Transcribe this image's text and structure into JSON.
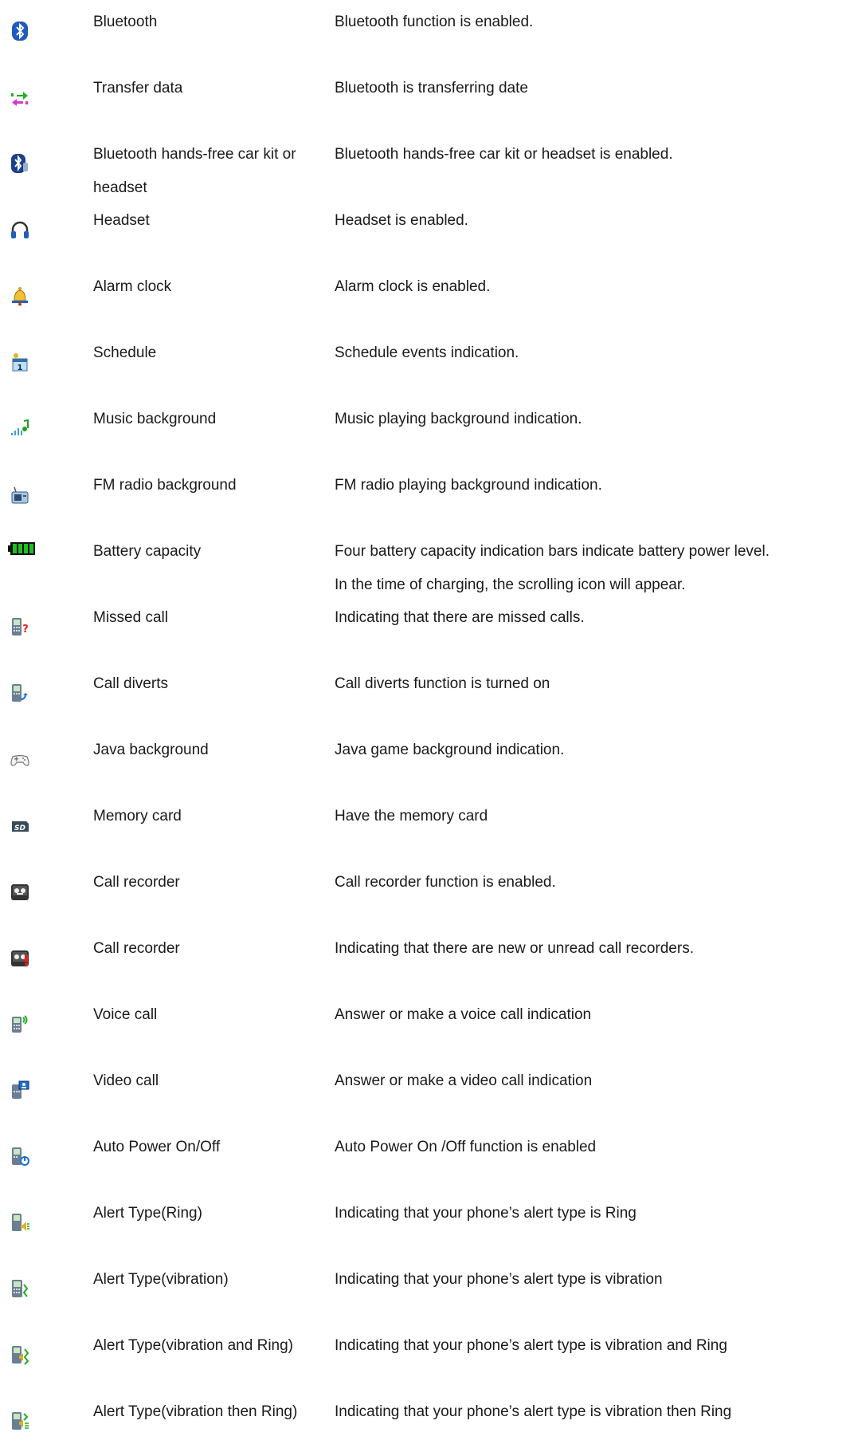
{
  "rows": [
    {
      "icon": "bluetooth-icon",
      "name": "Bluetooth",
      "description": "Bluetooth function is enabled."
    },
    {
      "icon": "transfer-data-icon",
      "name": "Transfer data",
      "description": "Bluetooth is transferring date"
    },
    {
      "icon": "bluetooth-headset-icon",
      "name": "Bluetooth hands-free car kit or headset",
      "description": "Bluetooth hands-free car kit or headset is enabled."
    },
    {
      "icon": "headset-icon",
      "name": "Headset",
      "description": "Headset is enabled."
    },
    {
      "icon": "alarm-bell-icon",
      "name": "Alarm clock",
      "description": "Alarm clock is enabled."
    },
    {
      "icon": "schedule-calendar-icon",
      "name": "Schedule",
      "description": "Schedule events indication."
    },
    {
      "icon": "music-note-icon",
      "name": "Music background",
      "description": "Music playing background indication."
    },
    {
      "icon": "fm-radio-icon",
      "name": "FM radio background",
      "description": "FM radio playing background indication."
    },
    {
      "icon": "battery-icon",
      "name": "Battery capacity",
      "description": "Four battery capacity indication bars indicate battery power level.",
      "description_line2": "In the time of charging, the scrolling icon will appear."
    },
    {
      "icon": "missed-call-icon",
      "name": "Missed call",
      "description": "Indicating that there are missed calls."
    },
    {
      "icon": "call-divert-icon",
      "name": "Call diverts",
      "description": "Call diverts function is turned on"
    },
    {
      "icon": "gamepad-icon",
      "name": "Java background",
      "description": "Java game background indication."
    },
    {
      "icon": "memory-card-icon",
      "name": "Memory card",
      "description": "Have the memory card"
    },
    {
      "icon": "call-recorder-icon",
      "name": "Call recorder",
      "description": "Call recorder function is enabled."
    },
    {
      "icon": "call-recorder-new-icon",
      "name": "Call recorder",
      "description": "Indicating that there are new or unread call recorders."
    },
    {
      "icon": "voice-call-icon",
      "name": "Voice call",
      "description": "Answer or make a voice call indication"
    },
    {
      "icon": "video-call-icon",
      "name": "Video call",
      "description": "Answer or make a video call indication"
    },
    {
      "icon": "auto-power-icon",
      "name": "Auto Power On/Off",
      "description": "Auto Power On /Off function is enabled"
    },
    {
      "icon": "alert-ring-icon",
      "name": "Alert Type(Ring)",
      "description": "Indicating that your phone’s alert type is Ring"
    },
    {
      "icon": "alert-vibration-icon",
      "name": "Alert Type(vibration)",
      "description": "Indicating that your phone’s alert type is vibration"
    },
    {
      "icon": "alert-vibration-ring-icon",
      "name": "Alert Type(vibration and Ring)",
      "description": "Indicating that your phone’s alert type is vibration and Ring"
    },
    {
      "icon": "alert-vibration-then-ring-icon",
      "name": "Alert Type(vibration then Ring)",
      "description": "Indicating that your phone’s alert type is vibration then Ring"
    }
  ]
}
